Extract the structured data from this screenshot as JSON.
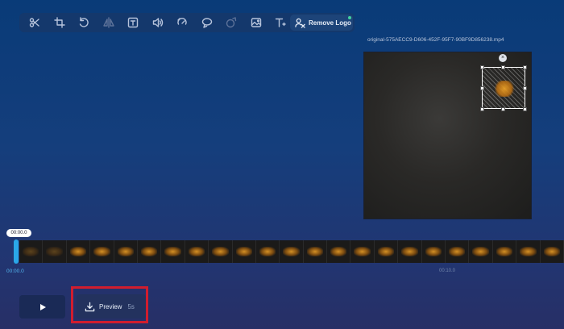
{
  "toolbar": {
    "tools": [
      "scissors-icon",
      "crop-icon",
      "rotate-icon",
      "flip-icon",
      "text-box-icon",
      "volume-icon",
      "speed-icon",
      "loop-icon",
      "filter-icon",
      "image-icon",
      "text-icon"
    ],
    "remove_logo_label": "Remove Logo"
  },
  "editor": {
    "filename": "original-575AECC9-D606-452F-95F7-90BF9D856238.mp4",
    "close_symbol": "×"
  },
  "timeline": {
    "playhead_time": "00:00.0",
    "start_time": "00:00.0",
    "mid_time": "00:10.0"
  },
  "controls": {
    "preview_label": "Preview",
    "preview_duration": "5s"
  },
  "colors": {
    "highlight": "#d11d2e",
    "playhead": "#2aa7e8"
  }
}
